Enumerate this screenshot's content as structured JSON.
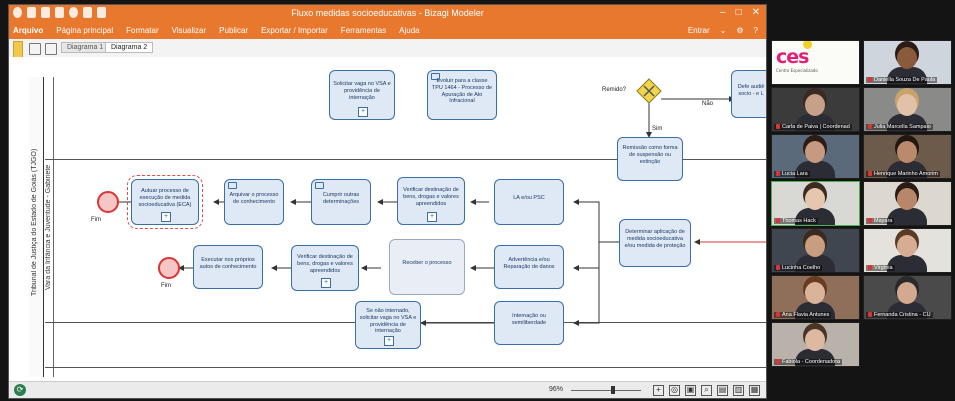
{
  "window": {
    "title": "Fluxo medidas socioeducativas - Bizagi Modeler"
  },
  "menubar": {
    "items": [
      "Arquivo",
      "Página principal",
      "Formatar",
      "Visualizar",
      "Publicar",
      "Exportar / Importar",
      "Ferramentas",
      "Ajuda"
    ],
    "right_label": "Entrar"
  },
  "tabs": {
    "diagram1": "Diagrama 1",
    "diagram2": "Diagrama 2"
  },
  "pool": {
    "title": "Tribunal de Justiça do Estado de Goiás (TJGO)",
    "lane": "Vara da Infância e Juventude - Gabinete"
  },
  "tasks": {
    "solicitar_vaga_top": "Solicitar vaga no VSA e providência de internação",
    "evoluir_classe": "Evoluir para a classe TPU 1464 - Processo de Apuração de Ato Infracional",
    "autuar": "Autuar processo de execução de medida socioeducativa (ECA)",
    "arquivar": "Arquivar o processo de conhecimento",
    "cumprir": "Cumprir outras determinações",
    "verificar_top": "Verificar destinação de bens, drogas e valores apreendidos",
    "la_ou_psc": "LA e/ou PSC",
    "remissao": "Remissão como forma de suspensão ou extinção",
    "determinar": "Determinar aplicação de medida socioeducativa e/ou medida de proteção",
    "executar": "Executar nos próprios autos de conhecimento",
    "verificar_bottom": "Verificar destinação de bens, drogas e valores apreendidos",
    "receber": "Receber o processo",
    "advertencia": "Advertência e/ou Reparação de danos",
    "solicitar_vaga_bottom": "Se não internado, solicitar vaga no VSA e providência de internação",
    "internacao": "Internação ou semiliberdade",
    "defe_partial": "Defe audiê socio - e L"
  },
  "gateway": {
    "question": "Remido?",
    "yes": "Sim",
    "no": "Não"
  },
  "events": {
    "end1": "Fim",
    "end2": "Fim"
  },
  "status": {
    "zoom": "96%"
  },
  "video": {
    "logo_text": "ces",
    "logo_sub": "Centro Especializado",
    "participants": [
      {
        "name": "Daniella Souza De Paula",
        "skin": "#8a5a3c",
        "bg": "#cfd5dc",
        "hair": "#2a1c14"
      },
      {
        "name": "Carla de Paiva | Coordenad",
        "skin": "#c7a088",
        "bg": "#3b3b3b",
        "hair": "#3a2a22"
      },
      {
        "name": "Julia Marcella Sampaio",
        "skin": "#e1c1a8",
        "bg": "#8a8a88",
        "hair": "#c8a46a"
      },
      {
        "name": "Lucia Lara",
        "skin": "#c59a80",
        "bg": "#5a6a7a",
        "hair": "#2b1d16"
      },
      {
        "name": "Henrique Marinho Amorim",
        "skin": "#b98a6c",
        "bg": "#6c5a4a",
        "hair": "#221812"
      },
      {
        "name": "Thomas Hack",
        "skin": "#e6c6ae",
        "bg": "#d8d8d4",
        "hair": "#3b2c20"
      },
      {
        "name": "Mayara",
        "skin": "#b8876a",
        "bg": "#dcd8d0",
        "hair": "#2a1c14"
      },
      {
        "name": "Lucinha Coelho",
        "skin": "#c99d80",
        "bg": "#3f4650",
        "hair": "#3a2a20"
      },
      {
        "name": "Virgínia",
        "skin": "#d6ad94",
        "bg": "#e4e2dc",
        "hair": "#5a3a24"
      },
      {
        "name": "Ana Flavia Antunes",
        "skin": "#d9b39a",
        "bg": "#8f6f5a",
        "hair": "#6a3a22"
      },
      {
        "name": "Fernanda Cristina - CU",
        "skin": "#d3aa90",
        "bg": "#4a4a4a",
        "hair": "#2a2a2a"
      },
      {
        "name": "Fabiola - Coordenadora",
        "skin": "#ddb9a2",
        "bg": "#b8b2aa",
        "hair": "#4a3424"
      }
    ]
  },
  "colors": {
    "accent": "#e9782f",
    "task_fill": "#dfe8f5",
    "task_border": "#3a6ea5",
    "end_event": "#e04b4b",
    "gateway": "#f2d54a"
  }
}
